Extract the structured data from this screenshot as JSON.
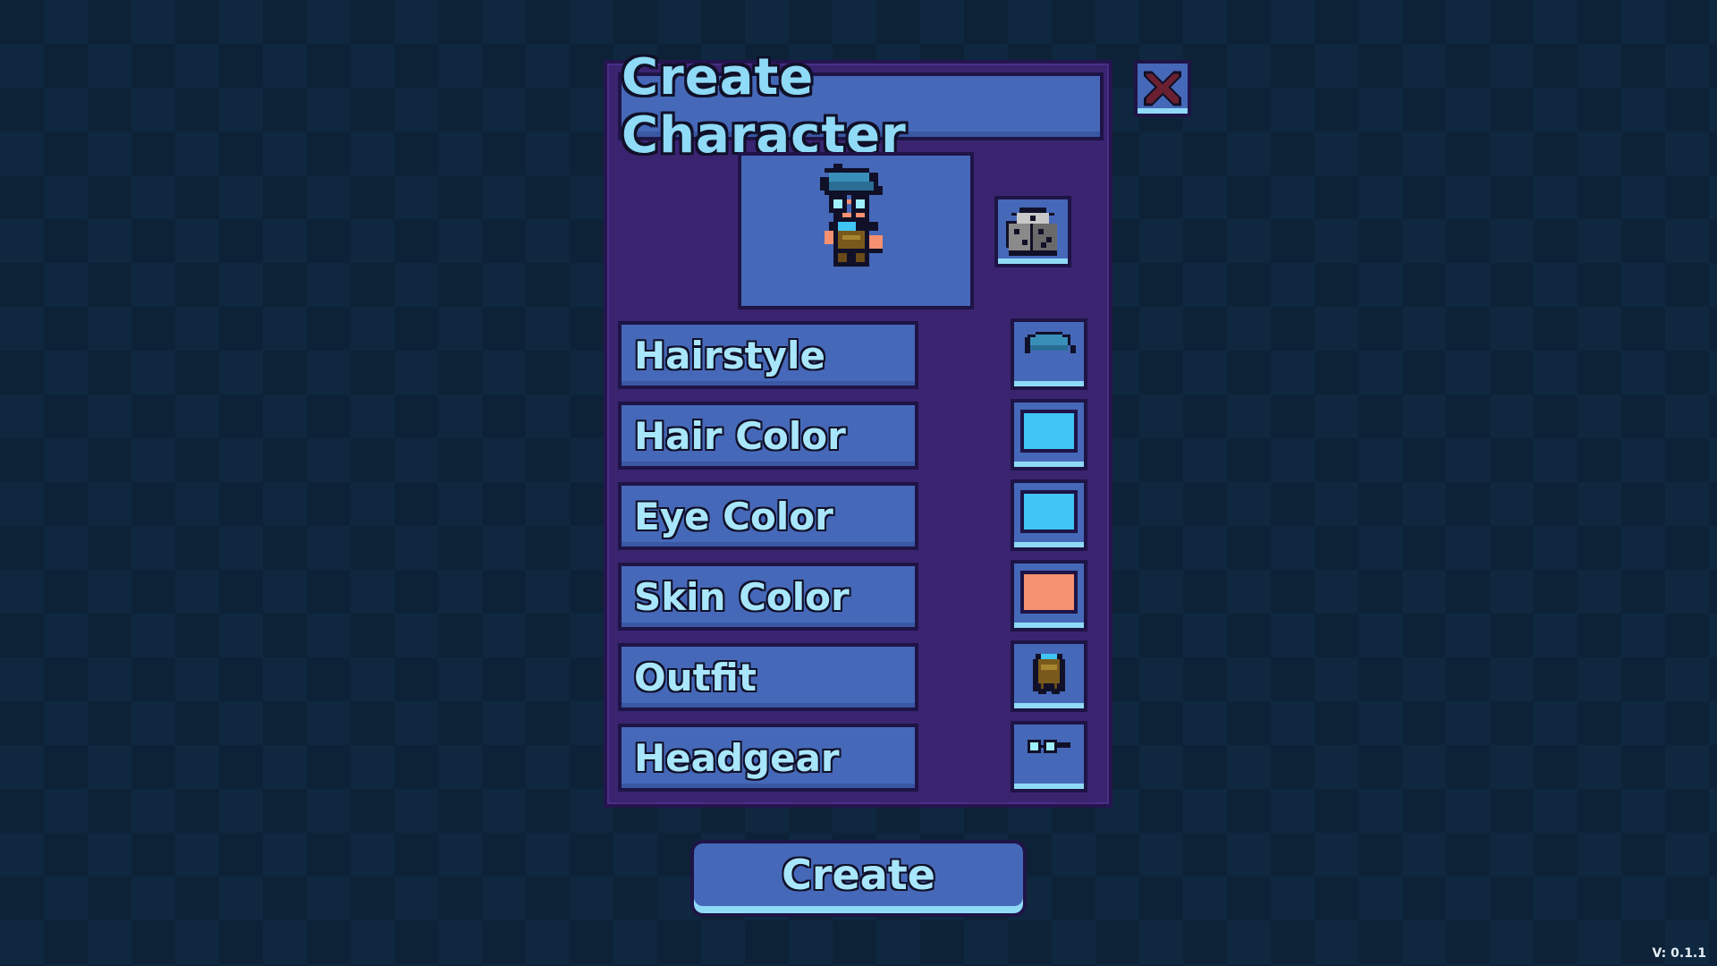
{
  "title": "Create Character",
  "options": [
    {
      "label": "Hairstyle",
      "swatch_type": "hair-icon"
    },
    {
      "label": "Hair Color",
      "swatch_type": "color",
      "color": "#3fc6f5"
    },
    {
      "label": "Eye Color",
      "swatch_type": "color",
      "color": "#3fc6f5"
    },
    {
      "label": "Skin Color",
      "swatch_type": "color",
      "color": "#f59070"
    },
    {
      "label": "Outfit",
      "swatch_type": "outfit-icon"
    },
    {
      "label": "Headgear",
      "swatch_type": "goggles-icon"
    }
  ],
  "create_label": "Create",
  "version": "V: 0.1.1",
  "icons": {
    "close": "close-x-icon",
    "randomize": "dice-icon"
  },
  "colors": {
    "panel": "#3a2470",
    "button": "#4668b8",
    "text": "#8fdaf6",
    "close_x": "#6a2030"
  }
}
